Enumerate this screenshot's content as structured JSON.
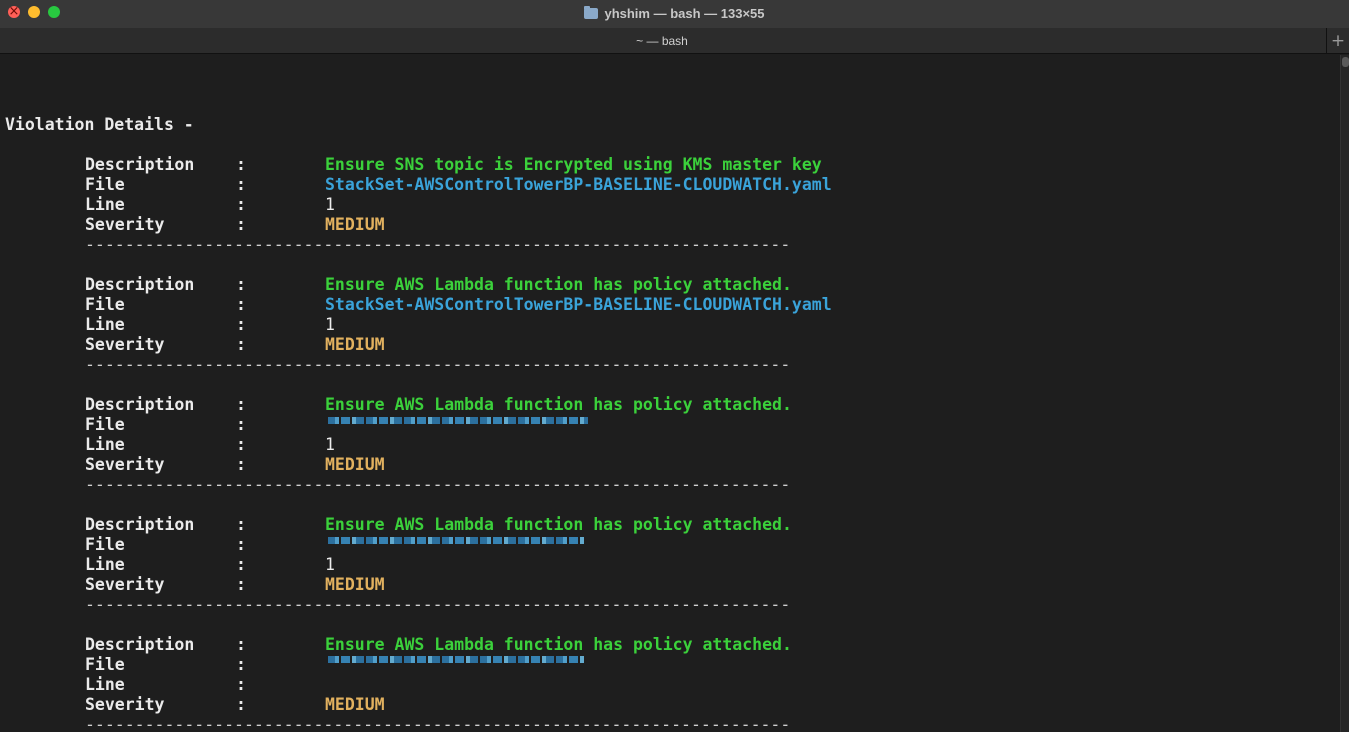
{
  "window": {
    "title": "yhshim — bash — 133×55",
    "tab_label": "~ — bash",
    "new_tab_label": "+"
  },
  "terminal": {
    "heading": "Violation Details -",
    "labels": {
      "description": "Description",
      "file": "File",
      "line": "Line",
      "severity": "Severity",
      "colon": ":"
    },
    "separator": "-----------------------------------------------------------------------",
    "violations": [
      {
        "description": "Ensure SNS topic is Encrypted using KMS master key",
        "file": "StackSet-AWSControlTowerBP-BASELINE-CLOUDWATCH.yaml",
        "line": "1",
        "severity": "MEDIUM"
      },
      {
        "description": "Ensure AWS Lambda function has policy attached.",
        "file": "StackSet-AWSControlTowerBP-BASELINE-CLOUDWATCH.yaml",
        "line": "1",
        "severity": "MEDIUM"
      },
      {
        "description": "Ensure AWS Lambda function has policy attached.",
        "file": "",
        "line": "1",
        "severity": "MEDIUM"
      },
      {
        "description": "Ensure AWS Lambda function has policy attached.",
        "file": "",
        "line": "1",
        "severity": "MEDIUM"
      },
      {
        "description": "Ensure AWS Lambda function has policy attached.",
        "file": "",
        "line": "",
        "severity": "MEDIUM"
      }
    ]
  }
}
